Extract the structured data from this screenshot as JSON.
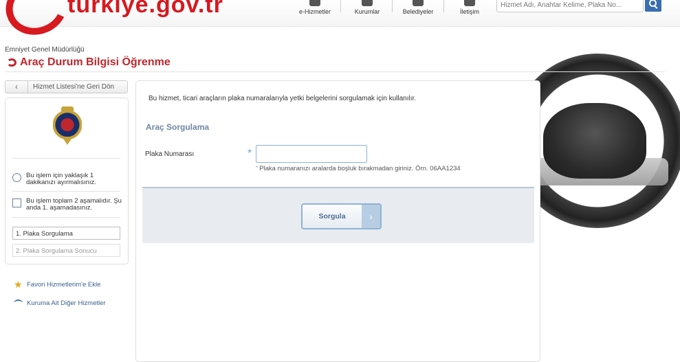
{
  "header": {
    "logo_text": "türkiye.gov.tr",
    "nav": [
      {
        "label": "e-Hizmetler",
        "icon": "e-services-icon"
      },
      {
        "label": "Kurumlar",
        "icon": "institutions-icon"
      },
      {
        "label": "Belediyeler",
        "icon": "municipalities-icon"
      },
      {
        "label": "İletişim",
        "icon": "contact-icon"
      }
    ],
    "search_placeholder": "Hizmet Adı, Anahtar Kelime, Plaka No..."
  },
  "page": {
    "breadcrumb": "Emniyet Genel Müdürlüğü",
    "title": "Araç Durum Bilgisi Öğrenme"
  },
  "sidebar": {
    "back_label": "Hizmet Listesi'ne Geri Dön",
    "badge_label": "POLİS",
    "info": [
      {
        "text": "Bu işlem için yaklaşık 1 dakikanızı ayırmalısınız.",
        "icon": "clock-icon"
      },
      {
        "text": "Bu işlem toplam 2 aşamalıdır. Şu anda 1. aşamadasınız.",
        "icon": "list-icon"
      }
    ],
    "steps": [
      "1. Plaka Sorgulama",
      "2. Plaka Sorgulama Sonucu"
    ],
    "links": [
      {
        "label": "Favori Hizmetlerim'e Ekle",
        "icon": "star-icon"
      },
      {
        "label": "Kuruma Ait Diğer Hizmetler",
        "icon": "link-arrow-icon"
      }
    ]
  },
  "main": {
    "intro": "Bu hizmet, ticari araçların plaka numaralarıyla yetki belgelerini sorgulamak için kullanılır.",
    "section_title": "Araç Sorgulama",
    "field_label": "Plaka Numarası",
    "field_value": "",
    "hint": "Plaka numaranızı aralarda boşluk bırakmadan giriniz. Örn. 06AA1234",
    "submit_label": "Sorgula"
  },
  "colors": {
    "brand_red": "#d71920",
    "title_red": "#c0272d",
    "accent_blue": "#4a6c93"
  }
}
